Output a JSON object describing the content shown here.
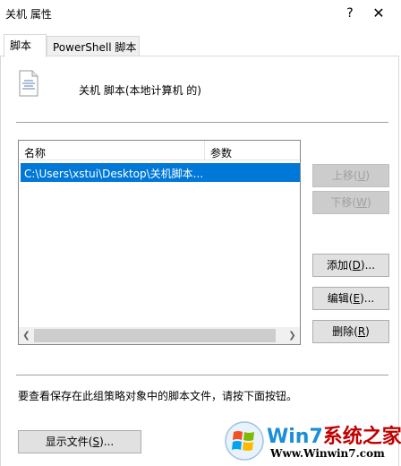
{
  "window": {
    "title": "关机 属性",
    "help_glyph": "?",
    "close_glyph": "✕"
  },
  "tabs": [
    {
      "label": "脚本",
      "active": true
    },
    {
      "label": "PowerShell 脚本",
      "active": false
    }
  ],
  "header": {
    "icon": "script-document-icon",
    "label": "关机 脚本(本地计算机 的)"
  },
  "list": {
    "columns": [
      "名称",
      "参数"
    ],
    "rows": [
      {
        "name": "C:\\Users\\xstui\\Desktop\\关机脚本...",
        "params": "",
        "selected": true
      }
    ]
  },
  "buttons": {
    "up": {
      "label": "上移(",
      "key": "U",
      "suffix": ")",
      "enabled": false
    },
    "down": {
      "label": "下移(",
      "key": "W",
      "suffix": ")",
      "enabled": false
    },
    "add": {
      "label": "添加(",
      "key": "D",
      "suffix": ")...",
      "enabled": true
    },
    "edit": {
      "label": "编辑(",
      "key": "E",
      "suffix": ")...",
      "enabled": true
    },
    "remove": {
      "label": "删除(",
      "key": "R",
      "suffix": ")",
      "enabled": true
    },
    "show_files": {
      "label": "显示文件(",
      "key": "S",
      "suffix": ")...",
      "enabled": true
    }
  },
  "info_text": "要查看保存在此组策略对象中的脚本文件，请按下面按钮。",
  "watermark": {
    "brand_part1": "Win7",
    "brand_part2": "系统之家",
    "url": "Www.Winwin7.com"
  },
  "colors": {
    "selection": "#0078d7",
    "button_bg": "#e1e1e1",
    "disabled_text": "#a0a0a0"
  }
}
